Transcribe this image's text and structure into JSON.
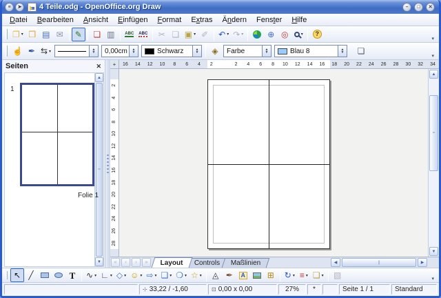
{
  "titlebar": {
    "title": "4 Teile.odg - OpenOffice.org Draw",
    "left_buttons": [
      {
        "name": "window-roll-up",
        "glyph": "≡"
      },
      {
        "name": "window-always-on-top",
        "glyph": "➤"
      }
    ],
    "window_buttons": [
      {
        "name": "minimize",
        "glyph": "–"
      },
      {
        "name": "maximize",
        "glyph": "□"
      },
      {
        "name": "close",
        "glyph": "✕"
      }
    ]
  },
  "menubar": {
    "items": [
      {
        "label": "Datei",
        "accel": 0
      },
      {
        "label": "Bearbeiten",
        "accel": 0
      },
      {
        "label": "Ansicht",
        "accel": 0
      },
      {
        "label": "Einfügen",
        "accel": 0
      },
      {
        "label": "Format",
        "accel": 0
      },
      {
        "label": "Extras",
        "accel": 1
      },
      {
        "label": "Ändern",
        "accel": 1
      },
      {
        "label": "Fenster",
        "accel": 4
      },
      {
        "label": "Hilfe",
        "accel": 0
      }
    ]
  },
  "toolbar_standard": {
    "items": [
      {
        "name": "new",
        "glyph": "❐",
        "color": "#e8b64c",
        "dropdown": true
      },
      {
        "name": "open",
        "glyph": "❒",
        "color": "#e8a33d"
      },
      {
        "name": "save",
        "glyph": "▤",
        "color": "#4a6fb5"
      },
      {
        "name": "email",
        "glyph": "✉",
        "color": "#8a94a8"
      },
      {
        "sep": true
      },
      {
        "name": "edit-file",
        "glyph": "✎",
        "color": "#2d7d2d",
        "pressed": true
      },
      {
        "sep": true
      },
      {
        "name": "export-pdf",
        "glyph": "❏",
        "color": "#c0392b"
      },
      {
        "name": "print",
        "glyph": "▥",
        "color": "#6a7488"
      },
      {
        "sep": true
      },
      {
        "name": "spellcheck",
        "glyph": "ABC",
        "cls": "abc",
        "color": "#1a4a1a"
      },
      {
        "name": "auto-spellcheck",
        "glyph": "ABC",
        "cls": "abcw",
        "color": "#1a1a4a"
      },
      {
        "sep": true
      },
      {
        "name": "cut",
        "glyph": "✂",
        "color": "#667",
        "disabled": true
      },
      {
        "name": "copy",
        "glyph": "❏",
        "color": "#667",
        "disabled": true
      },
      {
        "name": "paste",
        "glyph": "▣",
        "color": "#b8a24c",
        "dropdown": true
      },
      {
        "name": "format-paintbrush",
        "glyph": "✐",
        "color": "#667",
        "disabled": true
      },
      {
        "sep": true
      },
      {
        "name": "undo",
        "glyph": "↶",
        "color": "#2255cc",
        "dropdown": true
      },
      {
        "name": "redo",
        "glyph": "↷",
        "color": "#667",
        "dropdown": true,
        "disabled": true
      },
      {
        "sep": true
      },
      {
        "name": "globe",
        "glyph": "",
        "cls": "pie"
      },
      {
        "name": "hyperlink",
        "glyph": "⊕",
        "color": "#3a6fd0"
      },
      {
        "name": "navigator",
        "glyph": "◎",
        "color": "#c0392b"
      },
      {
        "name": "zoom",
        "glyph": "",
        "cls": "zoomglass",
        "dropdown": true
      },
      {
        "sep": true
      },
      {
        "name": "help",
        "glyph": "?",
        "cls": "help"
      }
    ],
    "overflow_glyph": "▾"
  },
  "toolbar_lineandfill": {
    "icons_left": [
      {
        "name": "styles-and-formatting",
        "glyph": "☝",
        "color": "#7a5230"
      },
      {
        "name": "line-dialog",
        "glyph": "✒",
        "color": "#2b4fa0"
      },
      {
        "name": "arrow-style",
        "glyph": "⇆",
        "color": "#333",
        "dropdown": true
      }
    ],
    "line_width_value": "0,00cm",
    "line_color_value": "Schwarz",
    "line_color_swatch": "#000000",
    "fill_type_value": "Farbe",
    "fill_color_value": "Blau 8",
    "fill_color_swatch": "#99ccff",
    "icons_right": [
      {
        "name": "area-dialog",
        "glyph": "◈",
        "color": "#8a6d1a"
      },
      {
        "name": "shadow-toggle",
        "glyph": "❏",
        "color": "#556",
        "shifted": true
      }
    ],
    "overflow_glyph": "▾"
  },
  "pages_panel": {
    "title": "Seiten",
    "close_glyph": "✕",
    "page_number": "1",
    "page_label": "Folie 1"
  },
  "rulers": {
    "unit": "cm",
    "origin_glyph": "+",
    "horizontal": [
      "16",
      "14",
      "12",
      "10",
      "8",
      "6",
      "4",
      "2",
      "",
      "2",
      "4",
      "6",
      "8",
      "10",
      "12",
      "14",
      "16",
      "18",
      "20",
      "22",
      "24",
      "26",
      "28",
      "30",
      "32",
      "34"
    ],
    "vertical": [
      "2",
      "4",
      "6",
      "8",
      "10",
      "12",
      "14",
      "16",
      "18",
      "20",
      "22",
      "24",
      "26",
      "28"
    ]
  },
  "tabs": {
    "items": [
      {
        "label": "Layout",
        "active": true
      },
      {
        "label": "Controls",
        "active": false
      },
      {
        "label": "Maßlinien",
        "active": false
      }
    ]
  },
  "pagenav": [
    {
      "name": "first-page",
      "glyph": "«"
    },
    {
      "name": "previous-page",
      "glyph": "‹"
    },
    {
      "name": "next-page",
      "glyph": "›"
    },
    {
      "name": "last-page",
      "glyph": "»"
    }
  ],
  "drawing_toolbar": {
    "items": [
      {
        "name": "select",
        "glyph": "↖",
        "color": "#111",
        "pressed": true
      },
      {
        "name": "line",
        "glyph": "╱",
        "color": "#333"
      },
      {
        "name": "rectangle",
        "glyph": "",
        "cls": "shp-rect"
      },
      {
        "name": "ellipse",
        "glyph": "",
        "cls": "shp-ellipse"
      },
      {
        "name": "text",
        "glyph": "T",
        "cls": "text-t"
      },
      {
        "sep": true
      },
      {
        "name": "curve",
        "glyph": "∿",
        "color": "#333",
        "dropdown": true
      },
      {
        "name": "connector",
        "glyph": "∟",
        "color": "#445",
        "dropdown": true
      },
      {
        "name": "basic-shapes",
        "glyph": "◇",
        "color": "#3a6fd0",
        "dropdown": true
      },
      {
        "name": "symbol-shapes",
        "glyph": "☺",
        "color": "#c8a000",
        "dropdown": true
      },
      {
        "name": "block-arrows",
        "glyph": "⇨",
        "color": "#3a6fd0",
        "dropdown": true
      },
      {
        "name": "flowchart",
        "glyph": "❏",
        "color": "#3a6fd0",
        "dropdown": true
      },
      {
        "name": "callouts",
        "glyph": "❍",
        "color": "#3a6fd0",
        "dropdown": true
      },
      {
        "name": "stars",
        "glyph": "☆",
        "color": "#c8a000",
        "dropdown": true
      },
      {
        "sep": true
      },
      {
        "name": "edit-points",
        "glyph": "◬",
        "color": "#333"
      },
      {
        "name": "gluepoints",
        "glyph": "✒",
        "color": "#7a5230"
      },
      {
        "name": "fontwork-gallery",
        "glyph": "A",
        "cls": "fontwork"
      },
      {
        "name": "from-file",
        "glyph": "",
        "cls": "shp-pic"
      },
      {
        "name": "gallery",
        "glyph": "⊞",
        "color": "#b8860b"
      },
      {
        "sep": true
      },
      {
        "name": "rotate",
        "glyph": "↻",
        "color": "#2255cc",
        "dropdown": true
      },
      {
        "name": "alignment",
        "glyph": "≡",
        "color": "#c0392b",
        "dropdown": true
      },
      {
        "name": "arrange",
        "glyph": "❏",
        "color": "#b8a24c",
        "dropdown": true
      },
      {
        "sep": true
      },
      {
        "name": "extrusion-toggle",
        "glyph": "▧",
        "color": "#667",
        "disabled": true
      }
    ],
    "overflow_glyph": "▾"
  },
  "statusbar": {
    "position_icon_glyph": "⊹",
    "position": "33,22 / -1,60",
    "size_icon_glyph": "⊡",
    "size": "0,00 x 0,00",
    "zoom": "27%",
    "modified": "*",
    "page": "Seite 1 / 1",
    "style": "Standard"
  },
  "scroll_glyphs": {
    "up": "▲",
    "down": "▼",
    "left": "◀",
    "right": "▶",
    "grip_v": "||",
    "grip_h": "||"
  }
}
